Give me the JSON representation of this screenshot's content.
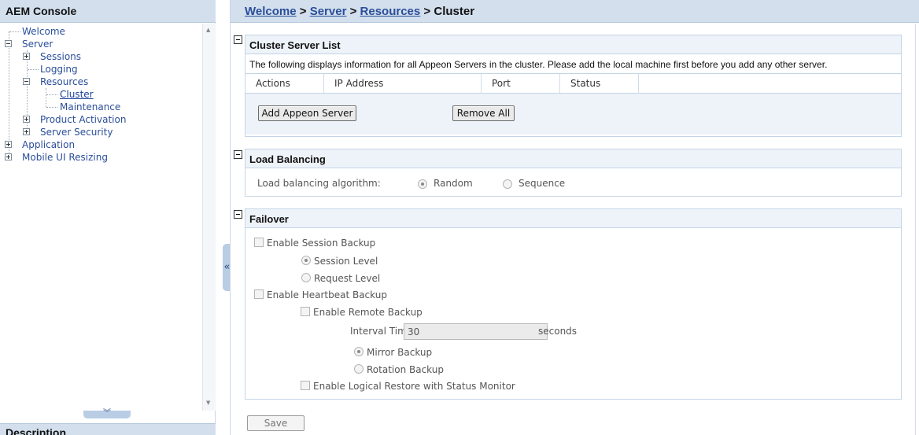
{
  "console": {
    "title": "AEM Console"
  },
  "tree": {
    "items": [
      {
        "label": "Welcome"
      },
      {
        "label": "Server"
      },
      {
        "label": "Sessions"
      },
      {
        "label": "Logging"
      },
      {
        "label": "Resources"
      },
      {
        "label": "Cluster"
      },
      {
        "label": "Maintenance"
      },
      {
        "label": "Product Activation"
      },
      {
        "label": "Server Security"
      },
      {
        "label": "Application"
      },
      {
        "label": "Mobile UI Resizing"
      }
    ]
  },
  "description_title": "Description",
  "breadcrumb": {
    "items": [
      "Welcome",
      "Server",
      "Resources"
    ],
    "separator": ">",
    "current": "Cluster"
  },
  "cluster_list": {
    "title": "Cluster Server List",
    "description": "The following displays information for all Appeon Servers in the cluster. Please add the local machine first before you add any other server.",
    "columns": [
      "Actions",
      "IP Address",
      "Port",
      "Status"
    ],
    "add_button": "Add Appeon Server",
    "remove_button": "Remove All"
  },
  "load_balancing": {
    "title": "Load Balancing",
    "label": "Load balancing algorithm:",
    "options": [
      "Random",
      "Sequence"
    ],
    "selected": "Random"
  },
  "failover": {
    "title": "Failover",
    "enable_session_backup": "Enable Session Backup",
    "session_level": "Session Level",
    "request_level": "Request Level",
    "enable_heartbeat_backup": "Enable Heartbeat Backup",
    "enable_remote_backup": "Enable Remote Backup",
    "interval_label": "Interval Time",
    "interval_value": "30",
    "interval_unit": "seconds",
    "mirror_backup": "Mirror Backup",
    "rotation_backup": "Rotation Backup",
    "enable_logical_restore": "Enable Logical Restore with Status Monitor"
  },
  "save_button": "Save",
  "icons": {
    "collapse_down": "double-chevron-down-icon",
    "collapse_left": "double-chevron-left-icon",
    "section_toggle": "minus-box-icon"
  },
  "colors": {
    "header_bg": "#d3dfed",
    "link": "#2a4e9a",
    "section_bg": "#eef3f9",
    "section_border": "#c5d5e6"
  }
}
